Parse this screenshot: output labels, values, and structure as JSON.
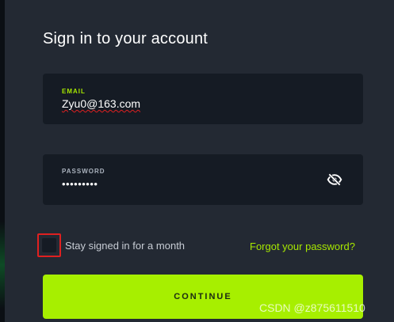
{
  "title": "Sign in to your account",
  "email": {
    "label": "EMAIL",
    "value": "Zyu0@163.com"
  },
  "password": {
    "label": "PASSWORD",
    "value": "•••••••••",
    "toggle_icon": "eye-slash-icon"
  },
  "stay_signed_in": {
    "label": "Stay signed in for a month",
    "checked": false
  },
  "forgot_password": "Forgot your password?",
  "continue_label": "CONTINUE",
  "watermark": "CSDN @z875611510",
  "colors": {
    "accent": "#a7ef00",
    "background": "#232933",
    "field_bg": "#151b24",
    "highlight_border": "#e02020"
  }
}
